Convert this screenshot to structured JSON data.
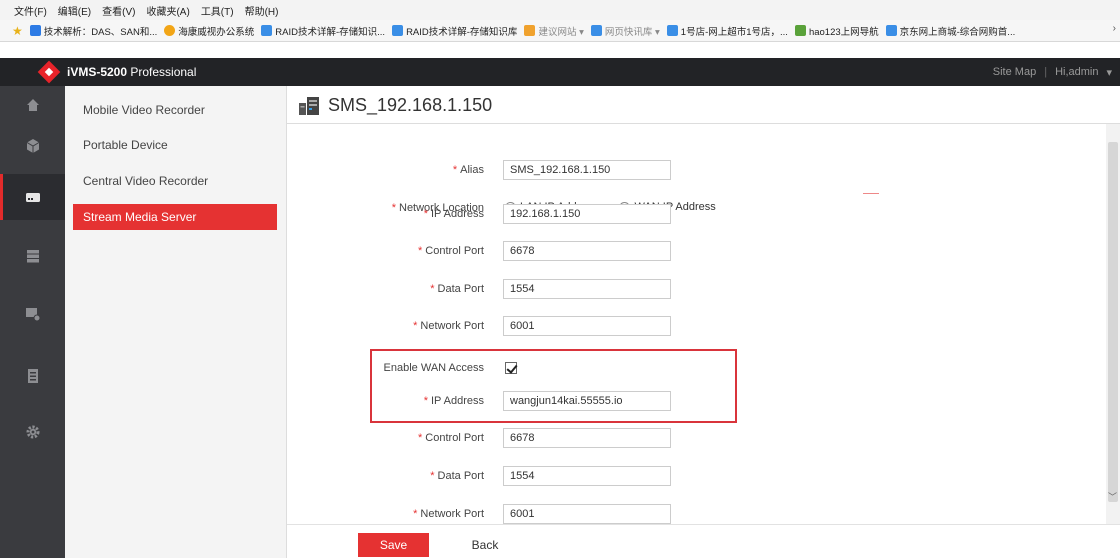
{
  "browser": {
    "menu": [
      "文件(F)",
      "编辑(E)",
      "查看(V)",
      "收藏夹(A)",
      "工具(T)",
      "帮助(H)"
    ],
    "favorites": [
      {
        "label": "技术解析：DAS、SAN和...",
        "color": "#2d7be5"
      },
      {
        "label": "海康威视办公系统",
        "color": "#f2a516"
      },
      {
        "label": "RAID技术详解-存储知识...",
        "color": "#3a8ee6"
      },
      {
        "label": "RAID技术详解-存储知识库",
        "color": "#3a8ee6"
      },
      {
        "label": "建议网站 ▾",
        "color": "#f0a22e",
        "dim": true
      },
      {
        "label": "网页快讯库 ▾",
        "color": "#3a8ee6",
        "dim": true
      },
      {
        "label": "1号店-网上超市1号店，...",
        "color": "#3a8ee6"
      },
      {
        "label": "hao123上网导航",
        "color": "#5aa23a"
      },
      {
        "label": "京东网上商城-综合网购首...",
        "color": "#3a8ee6"
      }
    ],
    "more": "›"
  },
  "app": {
    "title_bold": "iVMS-5200",
    "title_thin": " Professional",
    "site_map": "Site Map",
    "separator": "|",
    "user": "Hi,admin",
    "user_caret": "▾"
  },
  "submenu": {
    "items": [
      {
        "label": "Mobile Video Recorder"
      },
      {
        "label": "Portable Device"
      },
      {
        "label": "Central Video Recorder"
      },
      {
        "label": "Stream Media Server",
        "active": true
      }
    ]
  },
  "page": {
    "title": "SMS_192.168.1.150"
  },
  "form": {
    "alias": {
      "label": "Alias",
      "value": "SMS_192.168.1.150"
    },
    "network_location": {
      "label": "Network Location",
      "lan": "LAN IP Address",
      "wan": "WAN IP Address",
      "selected": "lan"
    },
    "ip_address": {
      "label": "IP Address",
      "value": "192.168.1.150"
    },
    "control_port": {
      "label": "Control Port",
      "value": "6678"
    },
    "data_port": {
      "label": "Data Port",
      "value": "1554"
    },
    "network_port": {
      "label": "Network Port",
      "value": "6001"
    },
    "enable_wan": {
      "label": "Enable WAN Access",
      "checked": true
    },
    "wan_ip_address": {
      "label": "IP Address",
      "value": "wangjun14kai.55555.io"
    },
    "wan_control_port": {
      "label": "Control Port",
      "value": "6678"
    },
    "wan_data_port": {
      "label": "Data Port",
      "value": "1554"
    },
    "wan_network_port": {
      "label": "Network Port",
      "value": "6001"
    },
    "required_mark": "*"
  },
  "footer": {
    "save": "Save",
    "back": "Back"
  },
  "colors": {
    "accent": "#e53232",
    "header_bg": "#222326",
    "rail_bg": "#3a3b3f"
  },
  "icons": {
    "rail": [
      "home-icon",
      "cube-icon",
      "device-icon",
      "server-icon",
      "monitor-settings-icon",
      "log-icon",
      "gear-icon"
    ]
  }
}
